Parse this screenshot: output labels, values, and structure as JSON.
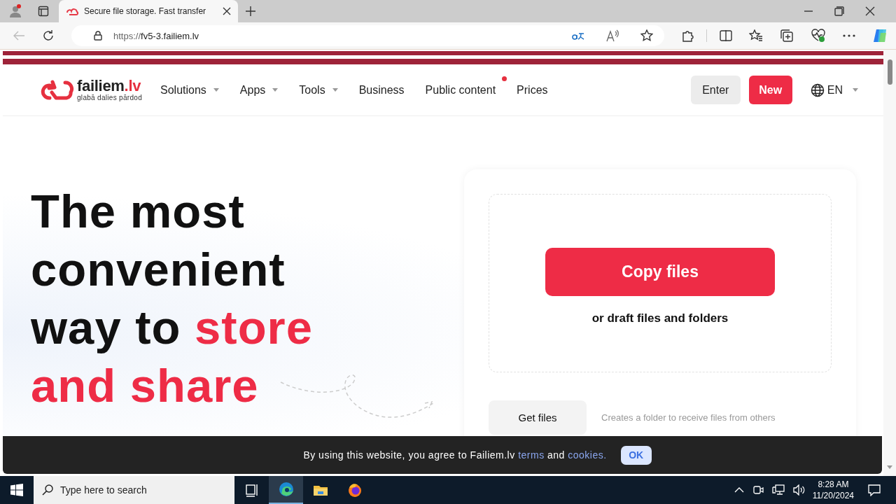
{
  "browser": {
    "tab_title": "Secure file storage. Fast transfer",
    "url_prefix": "https://",
    "url_host": "fv5-3.failiem.lv"
  },
  "header": {
    "logo_name": "failiem",
    "logo_tld": ".lv",
    "logo_tagline": "glabā dalies pārdod",
    "nav": [
      {
        "label": "Solutions",
        "dropdown": true,
        "badge": false
      },
      {
        "label": "Apps",
        "dropdown": true,
        "badge": false
      },
      {
        "label": "Tools",
        "dropdown": true,
        "badge": false
      },
      {
        "label": "Business",
        "dropdown": false,
        "badge": false
      },
      {
        "label": "Public content",
        "dropdown": false,
        "badge": true
      },
      {
        "label": "Prices",
        "dropdown": false,
        "badge": false
      }
    ],
    "enter": "Enter",
    "new": "New",
    "language": "EN"
  },
  "hero": {
    "heading": "The most convenient way to",
    "heading_accent": "store and share"
  },
  "upload": {
    "button": "Copy files",
    "hint": "or draft files and folders",
    "get_button": "Get files",
    "get_description": "Creates a folder to receive files from others"
  },
  "cookie": {
    "text_before": "By using this website, you agree to Failiem.lv",
    "link_terms": "terms",
    "middle": "and",
    "link_cookies": "cookies.",
    "ok": "OK"
  },
  "taskbar": {
    "search_placeholder": "Type here to search",
    "time": "8:28 AM",
    "date": "11/20/2024",
    "apps": [
      {
        "kind": "taskview",
        "selected": false
      },
      {
        "kind": "edge",
        "selected": true
      },
      {
        "kind": "explorer",
        "selected": false
      },
      {
        "kind": "firefox",
        "selected": false
      }
    ]
  }
}
